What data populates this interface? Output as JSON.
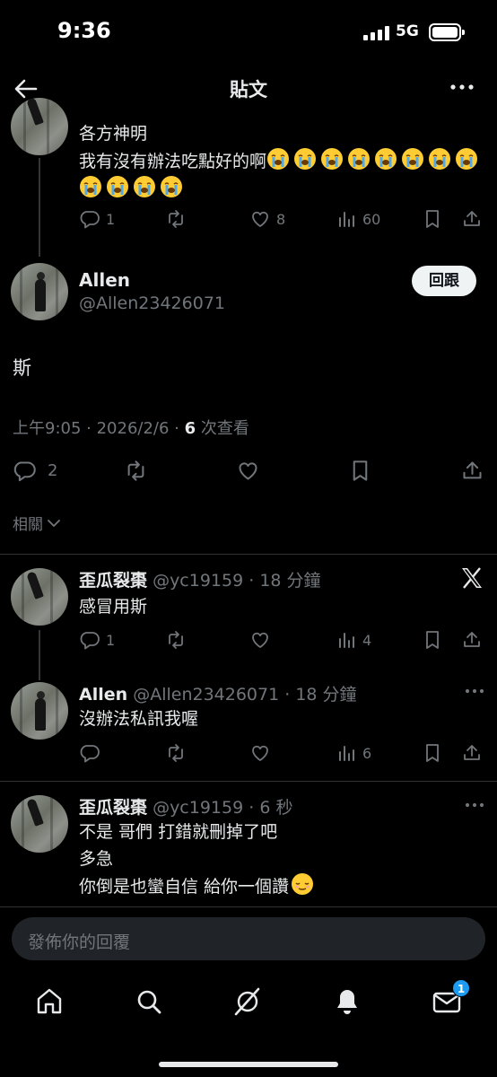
{
  "status_bar": {
    "time": "9:36",
    "network": "5G"
  },
  "header": {
    "title": "貼文"
  },
  "parent_tweet": {
    "line1": "各方神明",
    "line2": "我有沒有辦法吃點好的啊",
    "reply_count": "1",
    "like_count": "8",
    "view_count": "60"
  },
  "main_tweet": {
    "name": "Allen",
    "handle": "@Allen23426071",
    "follow_label": "回跟",
    "text": "斯",
    "time": "上午9:05 · 2026/2/6 · ",
    "views_number": "6",
    "views_suffix": " 次查看",
    "reply_count": "2"
  },
  "related_label": "相關",
  "replies": [
    {
      "name": "歪瓜裂棗",
      "meta": "@yc19159 · 18 分鐘",
      "text": "感冒用斯",
      "reply_count": "1",
      "view_count": "4"
    },
    {
      "name": "Allen",
      "meta": "@Allen23426071 · 18 分鐘",
      "text": "沒辦法私訊我喔",
      "view_count": "6"
    },
    {
      "name": "歪瓜裂棗",
      "meta": "@yc19159 · 6 秒",
      "line1": "不是 哥們 打錯就刪掉了吧",
      "line2": "多急",
      "line3": "你倒是也蠻自信 給你一個讚"
    }
  ],
  "reply_bar": {
    "placeholder": "發佈你的回覆"
  },
  "nav": {
    "messages_badge": "1"
  },
  "colors": {
    "background": "#000000",
    "text": "#e7e9ea",
    "muted": "#71767b",
    "accent": "#1d9bf0"
  }
}
